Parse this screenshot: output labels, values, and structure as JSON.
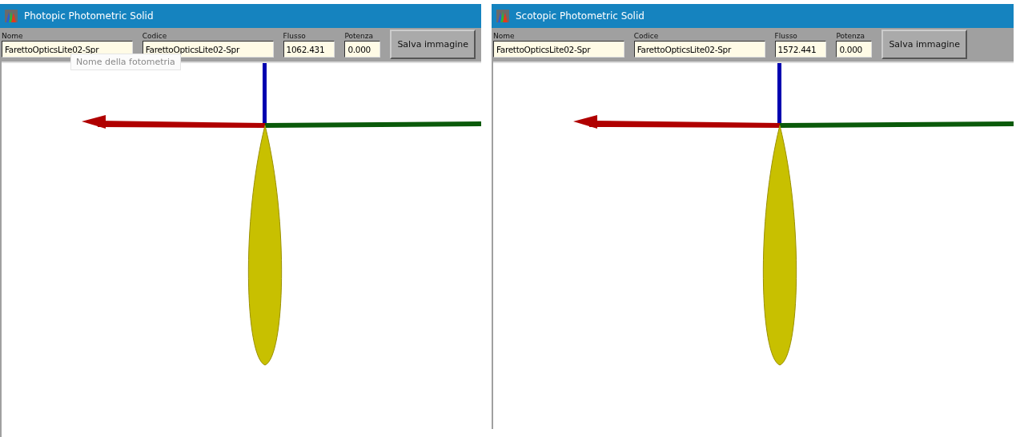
{
  "windows": [
    {
      "title": "Photopic Photometric Solid",
      "fields": [
        {
          "label": "Nome",
          "value": "FarettoOpticsLite02-Spr"
        },
        {
          "label": "Codice",
          "value": "FarettoOpticsLite02-Spr"
        },
        {
          "label": "Flusso",
          "value": "1062.431"
        },
        {
          "label": "Potenza",
          "value": "0.000"
        }
      ],
      "button": "Salva immagine",
      "tooltip": "Nome della fotometria"
    },
    {
      "title": "Scotopic Photometric Solid",
      "fields": [
        {
          "label": "Nome",
          "value": "FarettoOpticsLite02-Spr"
        },
        {
          "label": "Codice",
          "value": "FarettoOpticsLite02-Spr"
        },
        {
          "label": "Flusso",
          "value": "1572.441"
        },
        {
          "label": "Potenza",
          "value": "0.000"
        }
      ],
      "button": "Salva immagine"
    }
  ]
}
